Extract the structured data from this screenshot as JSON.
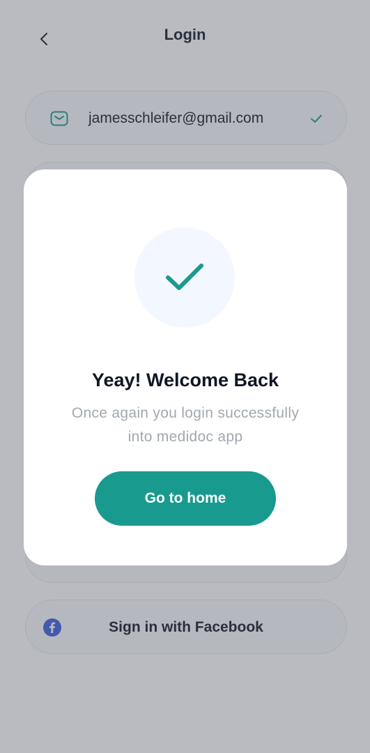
{
  "header": {
    "title": "Login",
    "back_icon": "chevron-left-icon"
  },
  "email_field": {
    "icon": "mail-icon",
    "value": "jamesschleifer@gmail.com",
    "status_icon": "check-icon"
  },
  "social": {
    "facebook_label": "Sign in with Facebook",
    "facebook_icon": "facebook-icon"
  },
  "modal": {
    "icon": "check-icon",
    "title": "Yeay! Welcome Back",
    "message_line1": "Once again you login successfully",
    "message_line2": "into medidoc app",
    "button_label": "Go to home"
  },
  "colors": {
    "primary": "#199a8e",
    "text_dark": "#101623",
    "text_muted": "#a1a8b0",
    "circle_bg": "#f3f7ff",
    "facebook_blue": "#3b5de0",
    "overlay": "rgba(80,86,100,0.40)"
  }
}
